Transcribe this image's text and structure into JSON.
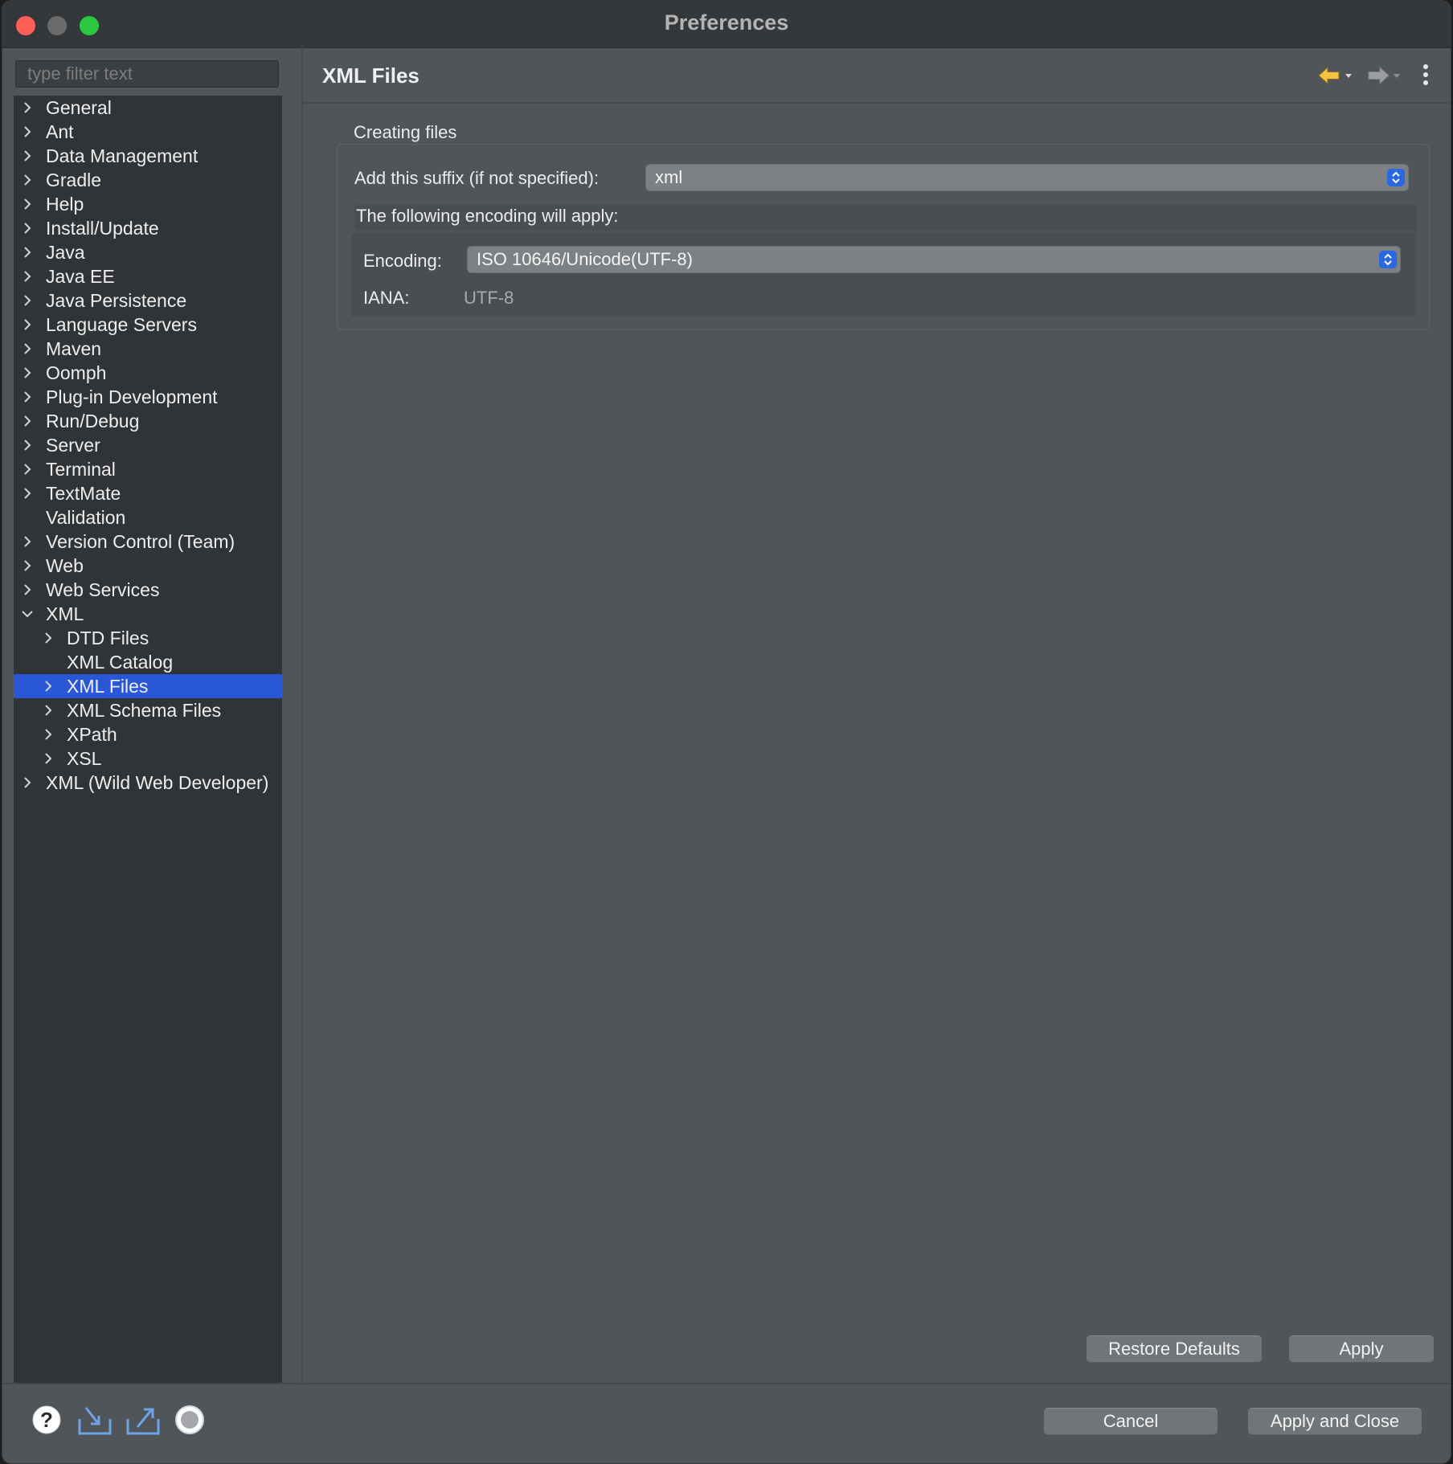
{
  "window": {
    "title": "Preferences"
  },
  "filter": {
    "placeholder": "type filter text"
  },
  "tree": [
    {
      "label": "General",
      "level": 0,
      "expandable": true
    },
    {
      "label": "Ant",
      "level": 0,
      "expandable": true
    },
    {
      "label": "Data Management",
      "level": 0,
      "expandable": true
    },
    {
      "label": "Gradle",
      "level": 0,
      "expandable": true
    },
    {
      "label": "Help",
      "level": 0,
      "expandable": true
    },
    {
      "label": "Install/Update",
      "level": 0,
      "expandable": true
    },
    {
      "label": "Java",
      "level": 0,
      "expandable": true
    },
    {
      "label": "Java EE",
      "level": 0,
      "expandable": true
    },
    {
      "label": "Java Persistence",
      "level": 0,
      "expandable": true
    },
    {
      "label": "Language Servers",
      "level": 0,
      "expandable": true
    },
    {
      "label": "Maven",
      "level": 0,
      "expandable": true
    },
    {
      "label": "Oomph",
      "level": 0,
      "expandable": true
    },
    {
      "label": "Plug-in Development",
      "level": 0,
      "expandable": true
    },
    {
      "label": "Run/Debug",
      "level": 0,
      "expandable": true
    },
    {
      "label": "Server",
      "level": 0,
      "expandable": true
    },
    {
      "label": "Terminal",
      "level": 0,
      "expandable": true
    },
    {
      "label": "TextMate",
      "level": 0,
      "expandable": true
    },
    {
      "label": "Validation",
      "level": 0,
      "expandable": false
    },
    {
      "label": "Version Control (Team)",
      "level": 0,
      "expandable": true
    },
    {
      "label": "Web",
      "level": 0,
      "expandable": true
    },
    {
      "label": "Web Services",
      "level": 0,
      "expandable": true
    },
    {
      "label": "XML",
      "level": 0,
      "expandable": true,
      "expanded": true
    },
    {
      "label": "DTD Files",
      "level": 1,
      "expandable": true
    },
    {
      "label": "XML Catalog",
      "level": 1,
      "expandable": false
    },
    {
      "label": "XML Files",
      "level": 1,
      "expandable": true,
      "selected": true
    },
    {
      "label": "XML Schema Files",
      "level": 1,
      "expandable": true
    },
    {
      "label": "XPath",
      "level": 1,
      "expandable": true
    },
    {
      "label": "XSL",
      "level": 1,
      "expandable": true
    },
    {
      "label": "XML (Wild Web Developer)",
      "level": 0,
      "expandable": true
    }
  ],
  "page": {
    "title": "XML Files",
    "group_label": "Creating files",
    "suffix_label": "Add this suffix (if not specified):",
    "suffix_value": "xml",
    "encoding_intro": "The following encoding will apply:",
    "encoding_label": "Encoding:",
    "encoding_value": "ISO 10646/Unicode(UTF-8)",
    "iana_label": "IANA:",
    "iana_value": "UTF-8",
    "restore_defaults": "Restore Defaults",
    "apply": "Apply"
  },
  "footer": {
    "cancel": "Cancel",
    "apply_and_close": "Apply and Close"
  },
  "colors": {
    "selection": "#2a57d6",
    "combo_accent": "#2a67e0",
    "back_arrow": "#f5c242"
  }
}
